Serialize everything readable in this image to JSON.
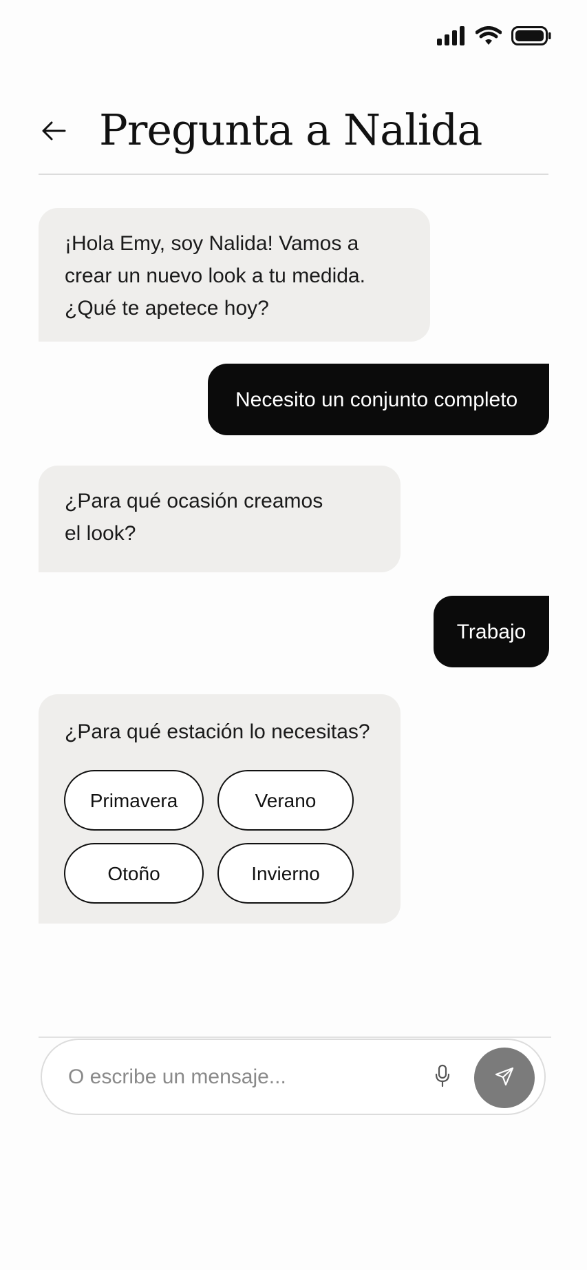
{
  "status_bar": {
    "icons": [
      "signal-icon",
      "wifi-icon",
      "battery-icon"
    ]
  },
  "header": {
    "back_icon": "arrow-left-icon",
    "title": "Pregunta a Nalida"
  },
  "messages": [
    {
      "role": "assistant",
      "lines": [
        "¡Hola Emy, soy Nalida! Vamos a",
        "crear un nuevo look a tu medida.",
        "¿Qué te apetece hoy?"
      ]
    },
    {
      "role": "user",
      "text": "Necesito un conjunto completo"
    },
    {
      "role": "assistant",
      "lines": [
        "¿Para qué ocasión creamos",
        "el look?"
      ]
    },
    {
      "role": "user",
      "text": "Trabajo"
    },
    {
      "role": "assistant",
      "text": "¿Para qué estación lo necesitas?",
      "options": [
        "Primavera",
        "Verano",
        "Otoño",
        "Invierno"
      ]
    }
  ],
  "composer": {
    "placeholder": "O escribe un mensaje...",
    "mic_icon": "microphone-icon",
    "send_icon": "send-icon"
  },
  "colors": {
    "bot_bubble": "#efeeec",
    "user_bubble": "#0b0b0b",
    "send_button": "#7b7b7b"
  }
}
